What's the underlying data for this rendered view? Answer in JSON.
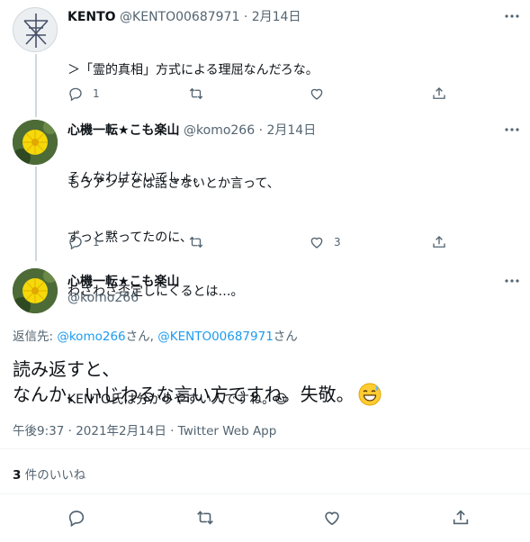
{
  "tweet1": {
    "name": "KENTO",
    "handle": "@KENTO00687971",
    "date": "· 2月14日",
    "lines": [
      "＞「霊的真相」方式による理屈なんだろな。",
      "",
      "そんなわけないでしょ。"
    ],
    "reply_count": "1",
    "retweet_count": "",
    "like_count": ""
  },
  "tweet2": {
    "name": "心機一転★こも楽山",
    "handle": "@komo266",
    "date": "· 2月14日",
    "lines": [
      "もうアンチとは話さないとか言って、",
      "ずっと黙ってたのに、",
      "わざわざ否定しにくるとは…。",
      "",
      "KENTO氏は分かりやすい人ですね。☺"
    ],
    "reply_count": "1",
    "retweet_count": "",
    "like_count": "3"
  },
  "main": {
    "name": "心機一転★こも楽山",
    "handle": "@komo266",
    "reply_to_prefix": "返信先: ",
    "reply_to_user1": "@komo266",
    "reply_to_sep": "さん, ",
    "reply_to_user2": "@KENTO00687971",
    "reply_to_suffix": "さん",
    "line1": "読み返すと、",
    "line2": "なんか、いじわるな言い方ですね。失敬。",
    "meta": "午後9:37 · 2021年2月14日 · Twitter Web App",
    "likes_count": "3",
    "likes_label": " 件のいいね"
  },
  "colors": {
    "accent": "#1d9bf0",
    "muted": "#536471",
    "divider": "#eff3f4",
    "thread_line": "#cfd9de"
  }
}
